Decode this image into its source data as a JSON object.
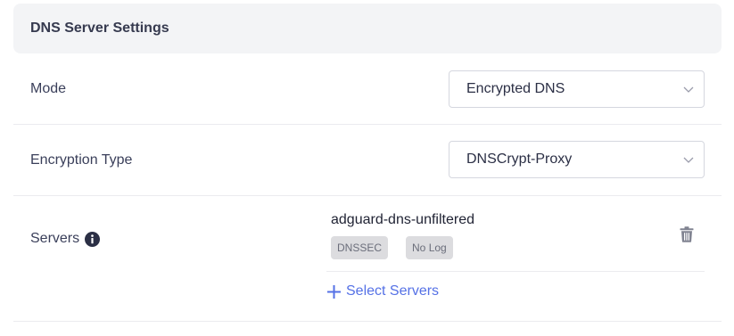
{
  "panel": {
    "title": "DNS Server Settings"
  },
  "mode": {
    "label": "Mode",
    "value": "Encrypted DNS"
  },
  "encryption": {
    "label": "Encryption Type",
    "value": "DNSCrypt-Proxy"
  },
  "servers": {
    "label": "Servers",
    "items": [
      {
        "name": "adguard-dns-unfiltered",
        "tags": [
          "DNSSEC",
          "No Log"
        ]
      }
    ],
    "add_label": "Select Servers"
  },
  "colors": {
    "accent": "#5571e6",
    "header_bg": "#f3f4f6",
    "tag_bg": "#dcdcdf"
  },
  "icons": {
    "info": "info-icon",
    "chevron": "chevron-down-icon",
    "delete": "trash-icon",
    "add": "plus-icon"
  }
}
